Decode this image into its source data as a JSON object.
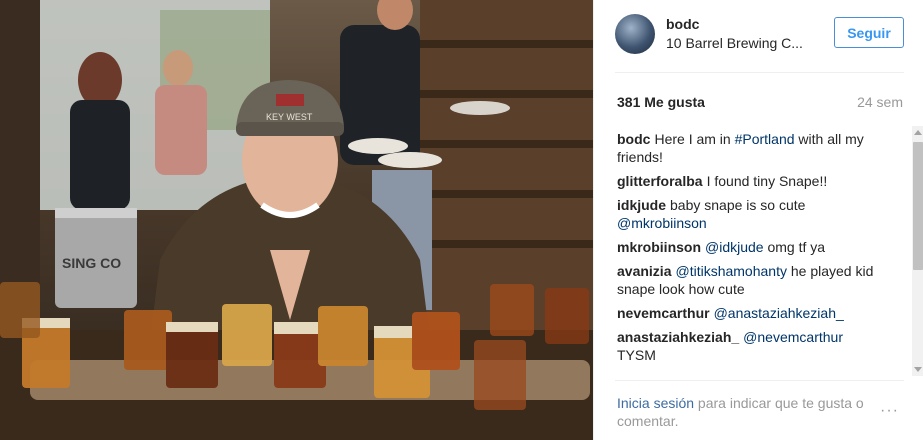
{
  "post": {
    "username": "bodc",
    "location": "10 Barrel Brewing C...",
    "follow_label": "Seguir",
    "likes": "381 Me gusta",
    "age": "24 sem"
  },
  "comments": [
    {
      "author": "bodc",
      "parts": [
        {
          "t": "Here I am in "
        },
        {
          "t": "#Portland",
          "link": true
        },
        {
          "t": " with all my friends!"
        }
      ]
    },
    {
      "author": "glitterforalba",
      "parts": [
        {
          "t": "I found tiny Snape!!"
        }
      ]
    },
    {
      "author": "idkjude",
      "parts": [
        {
          "t": "baby snape is so cute "
        },
        {
          "t": "@mkrobiinson",
          "link": true
        }
      ]
    },
    {
      "author": "mkrobiinson",
      "parts": [
        {
          "t": "@idkjude",
          "link": true
        },
        {
          "t": " omg tf ya"
        }
      ]
    },
    {
      "author": "avanizia",
      "parts": [
        {
          "t": "@titikshamohanty",
          "link": true
        },
        {
          "t": " he played kid snape look how cute"
        }
      ]
    },
    {
      "author": "nevemcarthur",
      "parts": [
        {
          "t": "@anastaziahkeziah_",
          "link": true
        }
      ]
    },
    {
      "author": "anastaziahkeziah_",
      "parts": [
        {
          "t": "@nevemcarthur",
          "link": true
        },
        {
          "t": " TYSM"
        }
      ]
    }
  ],
  "footer": {
    "login_link": "Inicia sesión",
    "login_text": " para indicar que te gusta o comentar.",
    "more": "···"
  },
  "photo_texts": {
    "cap_text": "KEY WEST",
    "keg_text": "SING CO"
  },
  "colors": {
    "accent": "#3897f0",
    "link": "#003569"
  }
}
